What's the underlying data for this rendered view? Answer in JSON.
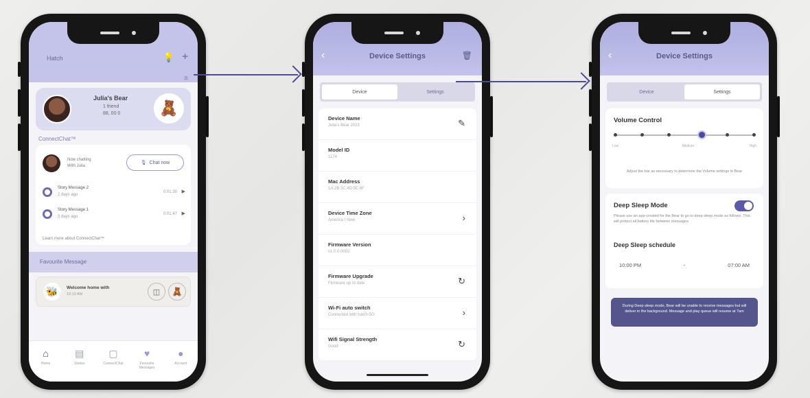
{
  "phone1": {
    "header_label": "Hatch",
    "profile": {
      "name": "Julia's Bear",
      "stat1": "1 friend",
      "stat2": "88, 00 0"
    },
    "connect_label": "ConnectChat™",
    "now_text_line1": "Now chatting",
    "now_text_line2": "With Julia",
    "chat_button": "Chat now",
    "messages": [
      {
        "title": "Story Message 2",
        "sub": "2 days ago",
        "time": "0:01:30"
      },
      {
        "title": "Story Message 1",
        "sub": "3 days ago",
        "time": "0:01:47"
      }
    ],
    "learn_more": "Learn more about ConnectChat™",
    "favorite_label": "Favourite Message",
    "favorite": {
      "title": "Welcome home with",
      "sub": "10:12 AM"
    },
    "tabs": [
      "Home",
      "Stories",
      "ConnectChat",
      "Favourite Messages",
      "Account"
    ]
  },
  "phone2": {
    "title": "Device Settings",
    "seg": [
      "Device",
      "Settings"
    ],
    "items": [
      {
        "label": "Device Name",
        "sub": "Julia's Bear 2023",
        "action": "✎"
      },
      {
        "label": "Model ID",
        "sub": "1174",
        "action": ""
      },
      {
        "label": "Mac Address",
        "sub": "1A:2B:3C:4D:5E:6F",
        "action": ""
      },
      {
        "label": "Device Time Zone",
        "sub": "America / New",
        "action": "›"
      },
      {
        "label": "Firmware Version",
        "sub": "v1.0.0.0002",
        "action": ""
      },
      {
        "label": "Firmware Upgrade",
        "sub": "Firmware up to date",
        "action": "↻"
      },
      {
        "label": "Wi-Fi auto switch",
        "sub": "Connected with hatch-5G",
        "action": "›"
      },
      {
        "label": "Wifi Signal Strength",
        "sub": "Good",
        "action": "↻"
      }
    ]
  },
  "phone3": {
    "title": "Device Settings",
    "seg": [
      "Device",
      "Settings"
    ],
    "volume_title": "Volume Control",
    "volume_low": "Low",
    "volume_med": "Medium",
    "volume_high": "High",
    "volume_level": 0.62,
    "volume_desc": "Adjust the bar as necessary to determine the Volume settings in Bear",
    "deep_title": "Deep Sleep Mode",
    "deep_desc": "Please use an app-created for the Bear to go to deep sleep mode as follows. This will protect all battery life between messages",
    "schedule_title": "Deep Sleep schedule",
    "time_start": "10:00 PM",
    "time_sep": "-",
    "time_end": "07:00 AM",
    "notice": "During Deep sleep mode, Bear will be unable to receive messages but will deliver in the background. Message and play queue will resume at 7am"
  },
  "colors": {
    "accent": "#4a4a9a",
    "header": "#b8b8e6",
    "notice": "#55558e"
  }
}
